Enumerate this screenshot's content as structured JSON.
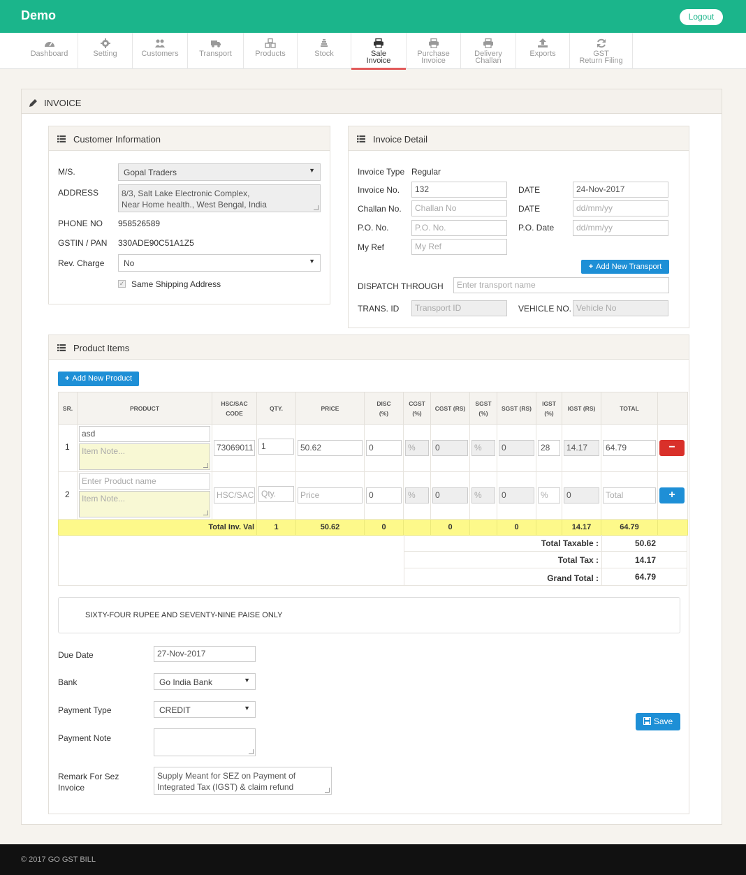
{
  "app": {
    "brand": "Demo",
    "logout_label": "Logout"
  },
  "nav": [
    {
      "label": "Dashboard",
      "icon": "dashboard-icon"
    },
    {
      "label": "Setting",
      "icon": "gear-icon"
    },
    {
      "label": "Customers",
      "icon": "users-icon"
    },
    {
      "label": "Transport",
      "icon": "truck-icon"
    },
    {
      "label": "Products",
      "icon": "cubes-icon"
    },
    {
      "label": "Stock",
      "icon": "stack-icon"
    },
    {
      "label": "Sale Invoice",
      "line1": "Sale",
      "line2": "Invoice",
      "icon": "print-icon",
      "active": true
    },
    {
      "label": "Purchase Invoice",
      "line1": "Purchase",
      "line2": "Invoice",
      "icon": "print-icon"
    },
    {
      "label": "Delivery Challan",
      "line1": "Delivery",
      "line2": "Challan",
      "icon": "print-icon"
    },
    {
      "label": "Exports",
      "icon": "upload-icon"
    },
    {
      "label": "GST Return Filing",
      "line1": "GST",
      "line2": "Return Filing",
      "icon": "refresh-icon"
    }
  ],
  "page_title": "INVOICE",
  "customer": {
    "title": "Customer Information",
    "ms_label": "M/S.",
    "ms_value": "Gopal Traders",
    "address_label": "ADDRESS",
    "address_line1": "8/3, Salt Lake Electronic Complex,",
    "address_line2": "Near Home health., West Bengal, India",
    "phone_label": "PHONE NO",
    "phone_value": "958526589",
    "gstin_label": "GSTIN / PAN",
    "gstin_value": "330ADE90C51A1Z5",
    "rev_label": "Rev. Charge",
    "rev_value": "No",
    "same_shipping_label": "Same Shipping Address"
  },
  "invoice": {
    "title": "Invoice Detail",
    "type_label": "Invoice Type",
    "type_value": "Regular",
    "no_label": "Invoice No.",
    "no_value": "132",
    "date_label": "DATE",
    "date_value": "24-Nov-2017",
    "challan_label": "Challan No.",
    "challan_placeholder": "Challan No",
    "challan_date_label": "DATE",
    "challan_date_placeholder": "dd/mm/yy",
    "po_label": "P.O. No.",
    "po_placeholder": "P.O. No.",
    "po_date_label": "P.O. Date",
    "po_date_placeholder": "dd/mm/yy",
    "ref_label": "My Ref",
    "ref_placeholder": "My Ref",
    "add_transport_label": "Add New Transport",
    "dispatch_label": "DISPATCH THROUGH",
    "dispatch_placeholder": "Enter transport name",
    "trans_id_label": "TRANS. ID",
    "trans_id_placeholder": "Transport ID",
    "vehicle_label": "VEHICLE NO.",
    "vehicle_placeholder": "Vehicle No"
  },
  "products": {
    "title": "Product Items",
    "add_label": "Add New Product",
    "headers": {
      "sr": "SR.",
      "product": "PRODUCT",
      "hsn1": "HSC/SAC",
      "hsn2": "CODE",
      "qty": "QTY.",
      "price": "PRICE",
      "disc1": "DISC",
      "disc2": "(%)",
      "cgst1": "CGST",
      "cgst2": "(%)",
      "cgst_rs": "CGST (RS)",
      "sgst1": "SGST",
      "sgst2": "(%)",
      "sgst_rs": "SGST (RS)",
      "igst1": "IGST",
      "igst2": "(%)",
      "igst_rs": "IGST (RS)",
      "total": "TOTAL"
    },
    "rows": [
      {
        "sr": "1",
        "product": "asd",
        "note_placeholder": "Item Note...",
        "hsn": "73069011",
        "qty": "1",
        "price": "50.62",
        "disc": "0",
        "cgst_pct": "%",
        "cgst_rs": "0",
        "sgst_pct": "%",
        "sgst_rs": "0",
        "igst_pct": "28",
        "igst_rs": "14.17",
        "total": "64.79",
        "action": "remove"
      },
      {
        "sr": "2",
        "product_placeholder": "Enter Product name",
        "note_placeholder": "Item Note...",
        "hsn_placeholder": "HSC/SAC",
        "qty_placeholder": "Qty.",
        "price_placeholder": "Price",
        "disc": "0",
        "cgst_pct": "%",
        "cgst_rs": "0",
        "sgst_pct": "%",
        "sgst_rs": "0",
        "igst_pct_placeholder": "%",
        "igst_rs": "0",
        "total_placeholder": "Total",
        "action": "add"
      }
    ],
    "totals_row": {
      "label": "Total Inv. Val",
      "qty": "1",
      "price": "50.62",
      "disc": "0",
      "cgst_rs": "0",
      "sgst_rs": "0",
      "igst_rs": "14.17",
      "total": "64.79"
    },
    "summary": [
      {
        "label": "Total Taxable :",
        "value": "50.62"
      },
      {
        "label": "Total Tax :",
        "value": "14.17"
      },
      {
        "label": "Grand Total :",
        "value": "64.79"
      }
    ]
  },
  "amount_words": "SIXTY-FOUR RUPEE AND SEVENTY-NINE PAISE ONLY",
  "footer_form": {
    "due_label": "Due Date",
    "due_value": "27-Nov-2017",
    "bank_label": "Bank",
    "bank_value": "Go India Bank",
    "ptype_label": "Payment Type",
    "ptype_value": "CREDIT",
    "pnote_label": "Payment Note",
    "remark_label1": "Remark For Sez",
    "remark_label2": "Invoice",
    "remark_line1": "Supply Meant for SEZ on Payment of",
    "remark_line2": "Integrated Tax (IGST) & claim refund",
    "save_label": "Save"
  },
  "copyright": "© 2017 GO GST BILL",
  "colors": {
    "brand": "#1bb58b",
    "primary": "#1e8fd6",
    "danger": "#d9302a",
    "totals_bg": "#fdf98a"
  }
}
